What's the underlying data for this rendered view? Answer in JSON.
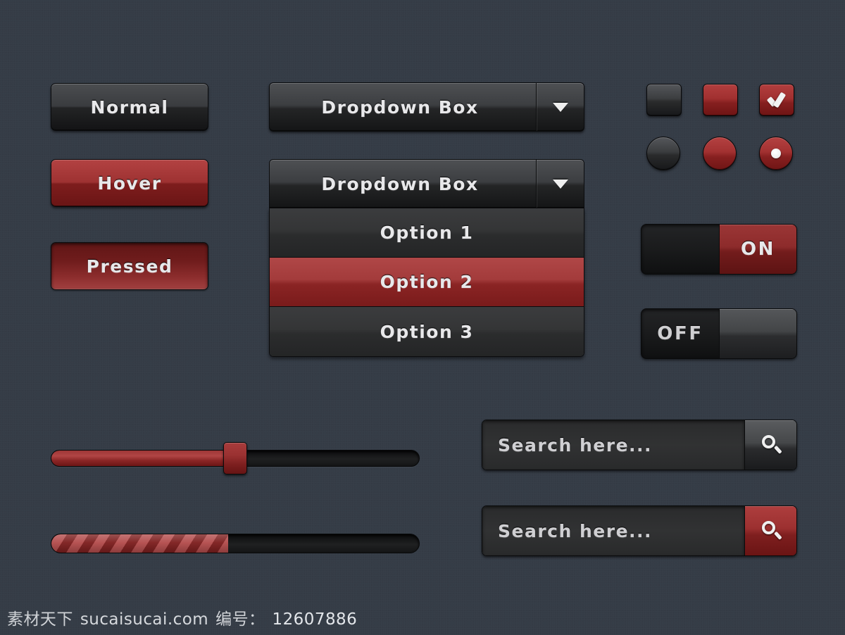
{
  "theme": {
    "background": "#353c46",
    "accent_red": "#a33030",
    "dark_gray": "#3a3c3f",
    "text_light": "#e8e8ea"
  },
  "buttons": [
    {
      "label": "Normal",
      "state": "normal"
    },
    {
      "label": "Hover",
      "state": "hover"
    },
    {
      "label": "Pressed",
      "state": "pressed"
    }
  ],
  "dropdown_closed": {
    "label": "Dropdown Box",
    "arrow_icon": "chevron-down-icon"
  },
  "dropdown_open": {
    "label": "Dropdown Box",
    "arrow_icon": "chevron-down-icon",
    "options": [
      {
        "label": "Option 1",
        "selected": false
      },
      {
        "label": "Option 2",
        "selected": true
      },
      {
        "label": "Option 3",
        "selected": false
      }
    ]
  },
  "checkboxes": [
    {
      "style": "dark",
      "checked": false
    },
    {
      "style": "red",
      "checked": false
    },
    {
      "style": "red",
      "checked": true,
      "icon": "check-icon"
    }
  ],
  "radios": [
    {
      "style": "dark",
      "selected": false
    },
    {
      "style": "red",
      "selected": false
    },
    {
      "style": "red",
      "selected": true,
      "icon": "radio-dot-icon"
    }
  ],
  "toggles": [
    {
      "label": "ON",
      "state": "on",
      "knob_side": "right",
      "knob_color": "red"
    },
    {
      "label": "OFF",
      "state": "off",
      "knob_side": "right",
      "knob_color": "gray"
    }
  ],
  "slider": {
    "value": 50,
    "min": 0,
    "max": 100,
    "fill_percent": 50,
    "handle_percent": 50
  },
  "progress": {
    "value": 48,
    "min": 0,
    "max": 100,
    "fill_percent": 48,
    "style": "striped"
  },
  "search_boxes": [
    {
      "placeholder": "Search here...",
      "value": "",
      "button_style": "gray",
      "button_icon": "search-icon"
    },
    {
      "placeholder": "Search here...",
      "value": "",
      "button_style": "red",
      "button_icon": "search-icon"
    }
  ],
  "footer": {
    "site_cn": "素材天下",
    "site_url": "sucaisucai.com",
    "id_label": "编号：",
    "id_value": "12607886"
  }
}
